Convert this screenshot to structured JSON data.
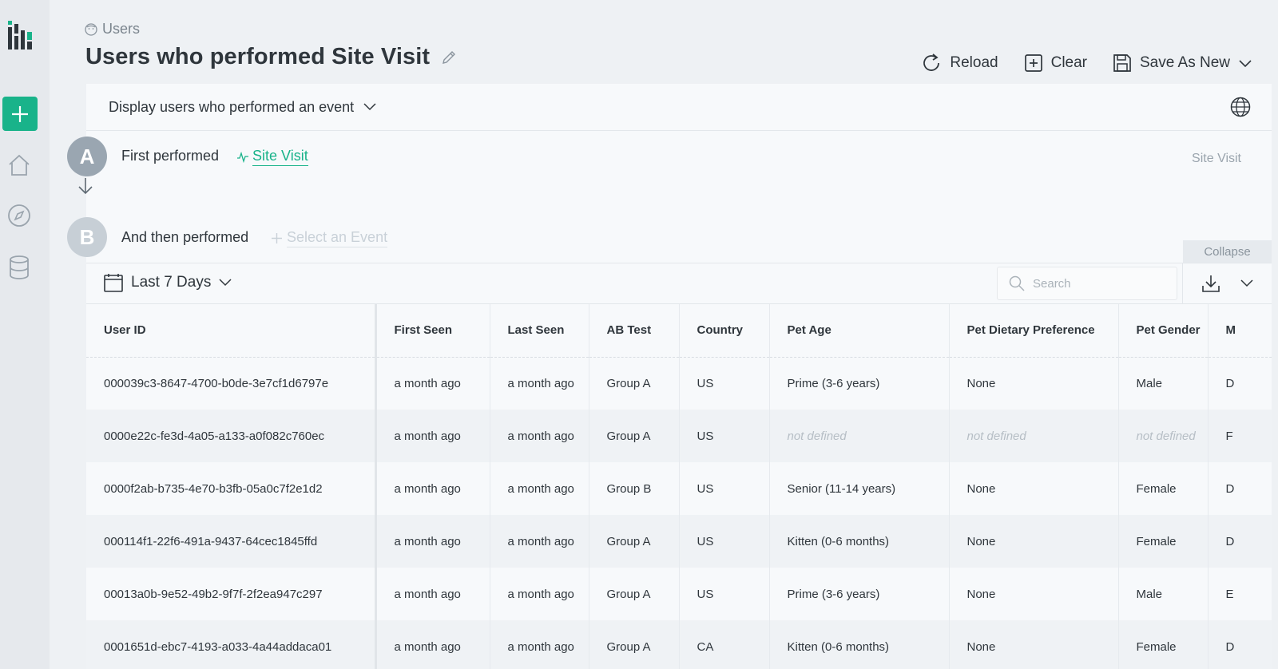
{
  "breadcrumb": {
    "label": "Users"
  },
  "page": {
    "title": "Users who performed Site Visit"
  },
  "toolbar": {
    "reload": "Reload",
    "clear": "Clear",
    "save": "Save As New"
  },
  "query": {
    "display_select": "Display users who performed an event",
    "step_a": {
      "letter": "A",
      "label": "First performed",
      "event": "Site Visit",
      "side_label": "Site Visit"
    },
    "step_b": {
      "letter": "B",
      "label": "And then performed",
      "placeholder": "Select an Event"
    },
    "collapse": "Collapse"
  },
  "table_bar": {
    "date_range": "Last 7 Days",
    "search_placeholder": "Search"
  },
  "table": {
    "headers": [
      "User ID",
      "First Seen",
      "Last Seen",
      "AB Test",
      "Country",
      "Pet Age",
      "Pet Dietary Preference",
      "Pet Gender",
      "M"
    ],
    "rows": [
      [
        "000039c3-8647-4700-b0de-3e7cf1d6797e",
        "a month ago",
        "a month ago",
        "Group A",
        "US",
        "Prime (3-6 years)",
        "None",
        "Male",
        "D"
      ],
      [
        "0000e22c-fe3d-4a05-a133-a0f082c760ec",
        "a month ago",
        "a month ago",
        "Group A",
        "US",
        "not defined",
        "not defined",
        "not defined",
        "F"
      ],
      [
        "0000f2ab-b735-4e70-b3fb-05a0c7f2e1d2",
        "a month ago",
        "a month ago",
        "Group B",
        "US",
        "Senior (11-14 years)",
        "None",
        "Female",
        "D"
      ],
      [
        "000114f1-22f6-491a-9437-64cec1845ffd",
        "a month ago",
        "a month ago",
        "Group A",
        "US",
        "Kitten (0-6 months)",
        "None",
        "Female",
        "D"
      ],
      [
        "00013a0b-9e52-49b2-9f7f-2f2ea947c297",
        "a month ago",
        "a month ago",
        "Group A",
        "US",
        "Prime (3-6 years)",
        "None",
        "Male",
        "E"
      ],
      [
        "0001651d-ebc7-4193-a033-4a44addaca01",
        "a month ago",
        "a month ago",
        "Group A",
        "CA",
        "Kitten (0-6 months)",
        "None",
        "Female",
        "D"
      ]
    ]
  },
  "colors": {
    "accent": "#19b38a",
    "sidebar": "#e6e9ed",
    "text": "#2f363c"
  }
}
